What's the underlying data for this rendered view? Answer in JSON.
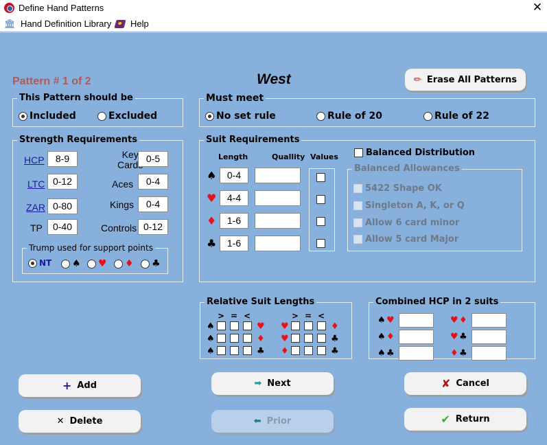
{
  "window": {
    "title": "Define Hand Patterns",
    "close_icon": "close-icon"
  },
  "menu": {
    "items": [
      {
        "label": "Hand Definition Library",
        "icon": "library-icon"
      },
      {
        "label": "Help",
        "icon": "help-book-icon"
      }
    ]
  },
  "header": {
    "pattern_label": "Pattern # 1 of 2",
    "player": "West",
    "erase_button": "Erase All Patterns"
  },
  "pattern_should_be": {
    "title": "This Pattern should be",
    "options": [
      {
        "label": "Included",
        "selected": true
      },
      {
        "label": "Excluded",
        "selected": false
      }
    ]
  },
  "must_meet": {
    "title": "Must meet",
    "options": [
      {
        "label": "No set rule",
        "selected": true
      },
      {
        "label": "Rule of 20",
        "selected": false
      },
      {
        "label": "Rule of 22",
        "selected": false
      }
    ]
  },
  "strength": {
    "title": "Strength Requirements",
    "left": [
      {
        "label": "HCP",
        "value": "8-9",
        "link": true
      },
      {
        "label": "LTC",
        "value": "0-12",
        "link": true
      },
      {
        "label": "ZAR",
        "value": "0-80",
        "link": true
      },
      {
        "label": "TP",
        "value": "0-40",
        "link": false
      }
    ],
    "right": [
      {
        "label": "Key",
        "label2": "Cards",
        "value": "0-5"
      },
      {
        "label": "Aces",
        "value": "0-4"
      },
      {
        "label": "Kings",
        "value": "0-4"
      },
      {
        "label": "Controls",
        "value": "0-12"
      }
    ],
    "trump": {
      "title": "Trump used for support points",
      "options": [
        {
          "label": "NT",
          "selected": true
        },
        {
          "label": "♠",
          "selected": false
        },
        {
          "label": "♥",
          "selected": false
        },
        {
          "label": "♦",
          "selected": false
        },
        {
          "label": "♣",
          "selected": false
        }
      ]
    }
  },
  "suit_requirements": {
    "title": "Suit Requirements",
    "headers": {
      "length": "Length",
      "quality": "Quallity",
      "values": "Values"
    },
    "rows": [
      {
        "suit": "♠",
        "length": "0-4",
        "quality": "",
        "values": false
      },
      {
        "suit": "♥",
        "length": "4-4",
        "quality": "",
        "values": false
      },
      {
        "suit": "♦",
        "length": "1-6",
        "quality": "",
        "values": false
      },
      {
        "suit": "♣",
        "length": "1-6",
        "quality": "",
        "values": false
      }
    ],
    "balanced": {
      "label": "Balanced Distribution",
      "checked": false
    },
    "allowances": {
      "title": "Balanced Allowances",
      "items": [
        {
          "label": "5422 Shape OK",
          "checked": false
        },
        {
          "label": "Singleton A, K, or Q",
          "checked": false
        },
        {
          "label": "Allow 6 card minor",
          "checked": false
        },
        {
          "label": "Allow 5 card Major",
          "checked": false
        }
      ]
    }
  },
  "relative_lengths": {
    "title": "Relative Suit Lengths",
    "headers": [
      ">",
      "=",
      "<"
    ],
    "left_rows": [
      {
        "a": "♠",
        "b": "♥"
      },
      {
        "a": "♠",
        "b": "♦"
      },
      {
        "a": "♠",
        "b": "♣"
      }
    ],
    "right_rows": [
      {
        "a": "♥",
        "b": "♦"
      },
      {
        "a": "♥",
        "b": "♣"
      },
      {
        "a": "♦",
        "b": "♣"
      }
    ]
  },
  "combined_hcp": {
    "title": "Combined HCP  in 2 suits",
    "left": [
      {
        "a": "♠",
        "b": "♥",
        "value": ""
      },
      {
        "a": "♠",
        "b": "♦",
        "value": ""
      },
      {
        "a": "♠",
        "b": "♣",
        "value": ""
      }
    ],
    "right": [
      {
        "a": "♥",
        "b": "♦",
        "value": ""
      },
      {
        "a": "♥",
        "b": "♣",
        "value": ""
      },
      {
        "a": "♦",
        "b": "♣",
        "value": ""
      }
    ]
  },
  "buttons": {
    "add": "Add",
    "delete": "Delete",
    "next": "Next",
    "prior": "Prior",
    "cancel": "Cancel",
    "return": "Return"
  },
  "icons": {
    "plus": "+",
    "x": "✕",
    "right_arrow": "➡",
    "left_arrow": "⬅",
    "cancel": "✘",
    "check": "✔",
    "close": "✕"
  }
}
